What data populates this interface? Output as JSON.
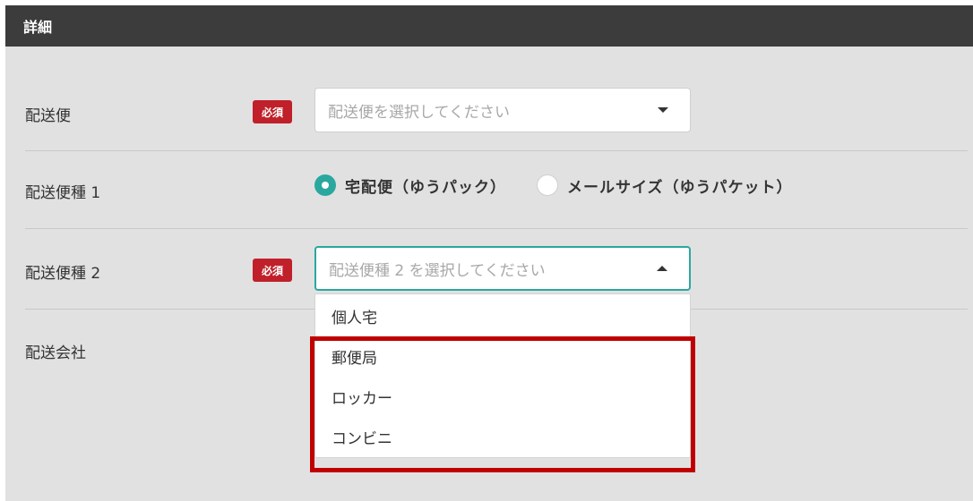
{
  "header": {
    "title": "詳細"
  },
  "required_label": "必須",
  "rows": {
    "carrier": {
      "label": "配送便",
      "placeholder": "配送便を選択してください"
    },
    "type1": {
      "label": "配送便種 1",
      "options": [
        {
          "label": "宅配便（ゆうパック）",
          "checked": true
        },
        {
          "label": "メールサイズ（ゆうパケット）",
          "checked": false
        }
      ]
    },
    "type2": {
      "label": "配送便種 2",
      "placeholder": "配送便種 2 を選択してください",
      "options": [
        "個人宅",
        "郵便局",
        "ロッカー",
        "コンビニ"
      ]
    },
    "company": {
      "label": "配送会社"
    }
  },
  "colors": {
    "accent": "#2aa89f",
    "required": "#c0202a",
    "highlight": "#c00000",
    "header_bg": "#3c3c3c"
  },
  "icons": [
    "chevron-down-icon",
    "chevron-up-icon",
    "radio-checked-icon",
    "radio-unchecked-icon"
  ]
}
